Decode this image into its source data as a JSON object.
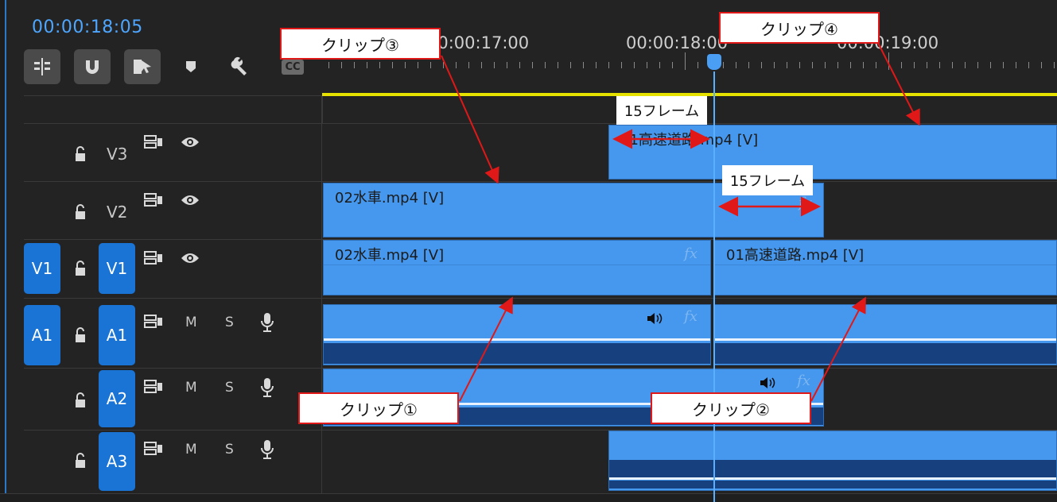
{
  "timecode": "00:00:18:05",
  "toolbar": {
    "tools": [
      "insert-nest-icon",
      "snap-magnet-icon",
      "linked-selection-icon",
      "marker-icon",
      "settings-wrench-icon",
      "captions-icon"
    ],
    "captions_label": "CC"
  },
  "ruler": {
    "labels": [
      "00:00:17:00",
      "00:00:18:00",
      "00:00:19:00"
    ]
  },
  "tracks": {
    "v3": {
      "name": "V3"
    },
    "v2": {
      "name": "V2"
    },
    "v1": {
      "source": "V1",
      "name": "V1"
    },
    "a1": {
      "source": "A1",
      "name": "A1",
      "mute": "M",
      "solo": "S"
    },
    "a2": {
      "name": "A2",
      "mute": "M",
      "solo": "S"
    },
    "a3": {
      "name": "A3",
      "mute": "M",
      "solo": "S"
    }
  },
  "clips": {
    "v3_clip": "01高速道路.mp4 [V]",
    "v2_clip": "02水車.mp4 [V]",
    "v1_clip_a": "02水車.mp4 [V]",
    "v1_clip_b": "01高速道路.mp4 [V]",
    "fx": "fx"
  },
  "annotations": {
    "clip1": "クリップ①",
    "clip2": "クリップ②",
    "clip3": "クリップ③",
    "clip4": "クリップ④",
    "frames_top": "15フレーム",
    "frames_mid": "15フレーム"
  },
  "colors": {
    "accent": "#1a74d6",
    "clip": "#4698ee",
    "playhead": "#5ab0ff",
    "annotation": "#e01818",
    "work_area": "#e7e100"
  }
}
